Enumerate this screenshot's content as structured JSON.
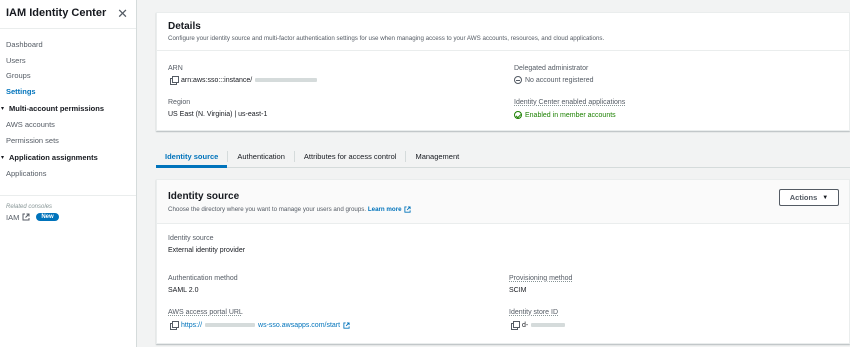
{
  "sidebar": {
    "title": "IAM Identity Center",
    "items_top": [
      {
        "label": "Dashboard",
        "active": false
      },
      {
        "label": "Users",
        "active": false
      },
      {
        "label": "Groups",
        "active": false
      },
      {
        "label": "Settings",
        "active": true
      }
    ],
    "section_multi": {
      "label": "Multi-account permissions",
      "items": [
        "AWS accounts",
        "Permission sets"
      ]
    },
    "section_app": {
      "label": "Application assignments",
      "items": [
        "Applications"
      ]
    },
    "related_label": "Related consoles",
    "iam_label": "IAM",
    "new_badge": "New"
  },
  "details": {
    "title": "Details",
    "description": "Configure your identity source and multi-factor authentication settings for use when managing access to your AWS accounts, resources, and cloud applications.",
    "arn_label": "ARN",
    "arn_value": "arn:aws:sso:::instance/",
    "region_label": "Region",
    "region_value": "US East (N. Virginia) | us-east-1",
    "delegated_label": "Delegated administrator",
    "delegated_value": "No account registered",
    "enabled_apps_label": "Identity Center enabled applications",
    "enabled_apps_value": "Enabled in member accounts"
  },
  "tabs": [
    {
      "label": "Identity source",
      "active": true
    },
    {
      "label": "Authentication",
      "active": false
    },
    {
      "label": "Attributes for access control",
      "active": false
    },
    {
      "label": "Management",
      "active": false
    }
  ],
  "identity_source": {
    "title": "Identity source",
    "description": "Choose the directory where you want to manage your users and groups.",
    "learn_more": "Learn more",
    "actions_label": "Actions",
    "source_label": "Identity source",
    "source_value": "External identity provider",
    "auth_method_label": "Authentication method",
    "auth_method_value": "SAML 2.0",
    "provisioning_label": "Provisioning method",
    "provisioning_value": "SCIM",
    "portal_label": "AWS access portal URL",
    "portal_prefix": "https://",
    "portal_suffix": "ws-sso.awsapps.com/start",
    "store_id_label": "Identity store ID",
    "store_id_prefix": "d-"
  },
  "colors": {
    "accent": "#0073bb",
    "success": "#1d8102",
    "text": "#16191f",
    "muted": "#545b64",
    "background": "#f2f3f3"
  }
}
